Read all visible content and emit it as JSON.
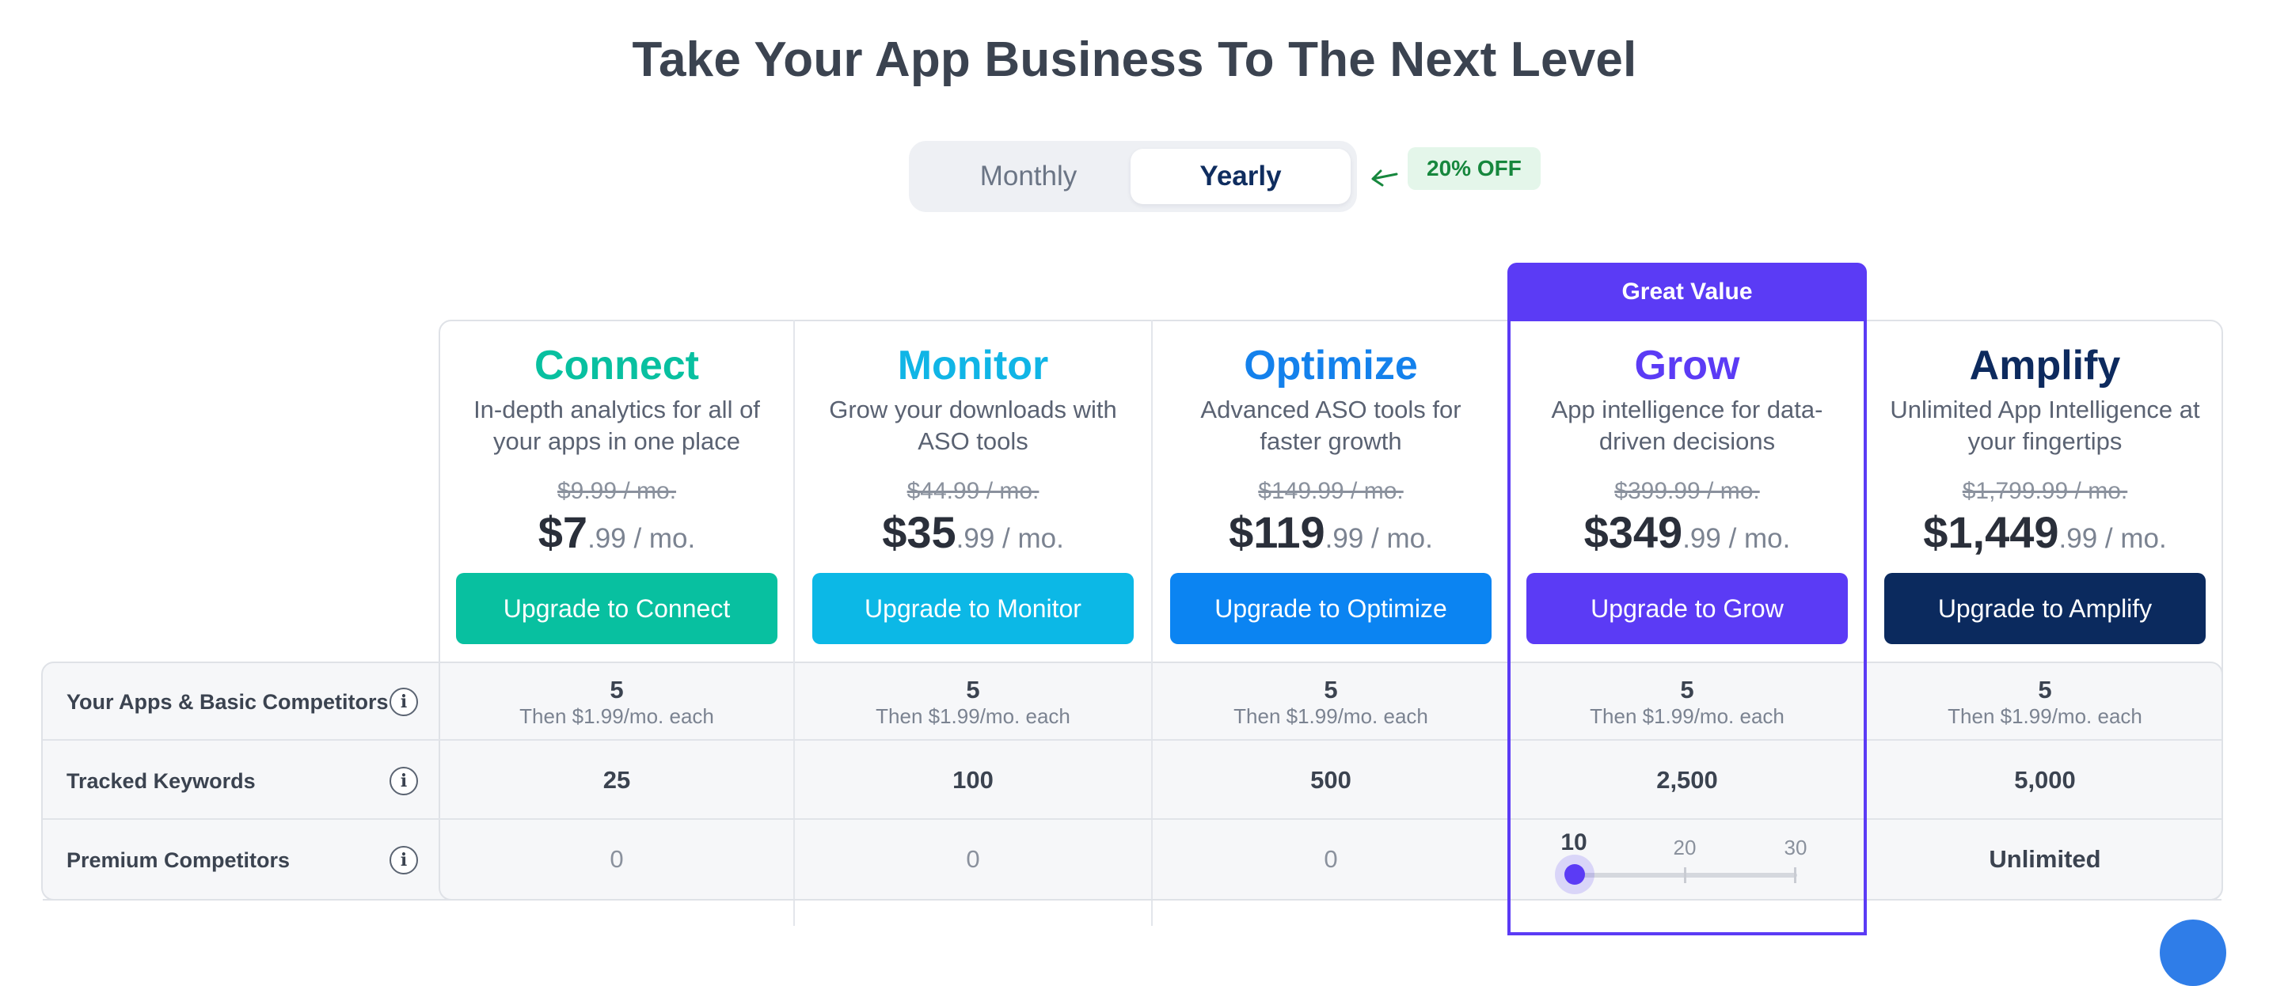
{
  "title": "Take Your App Business To The Next Level",
  "billing": {
    "monthly": "Monthly",
    "yearly": "Yearly",
    "selected": "Yearly",
    "discount": "20% OFF"
  },
  "highlight": {
    "label": "Great Value"
  },
  "plans": [
    {
      "name": "Connect",
      "color": "#08c0a0",
      "desc": "In-depth analytics for all of your apps in one place",
      "old_price": "$9.99 / mo.",
      "price_main": "$7",
      "price_cents": ".99 / mo.",
      "button": "Upgrade to Connect",
      "button_color": "#08c0a0"
    },
    {
      "name": "Monitor",
      "color": "#10b5e6",
      "desc": "Grow your downloads with ASO tools",
      "old_price": "$44.99 / mo.",
      "price_main": "$35",
      "price_cents": ".99 / mo.",
      "button": "Upgrade to Monitor",
      "button_color": "#0cb8e6"
    },
    {
      "name": "Optimize",
      "color": "#1481ec",
      "desc": "Advanced ASO tools for faster growth",
      "old_price": "$149.99 / mo.",
      "price_main": "$119",
      "price_cents": ".99 / mo.",
      "button": "Upgrade to Optimize",
      "button_color": "#0b84f2"
    },
    {
      "name": "Grow",
      "color": "#5b3bf5",
      "desc": "App intelligence for data-driven decisions",
      "old_price": "$399.99 / mo.",
      "price_main": "$349",
      "price_cents": ".99 / mo.",
      "button": "Upgrade to Grow",
      "button_color": "#5b3bf5"
    },
    {
      "name": "Amplify",
      "color": "#0d2a5e",
      "desc": "Unlimited App Intelligence at your fingertips",
      "old_price": "$1,799.99 / mo.",
      "price_main": "$1,449",
      "price_cents": ".99 / mo.",
      "button": "Upgrade to Amplify",
      "button_color": "#0b2a5e"
    }
  ],
  "features": [
    {
      "label": "Your Apps & Basic Competitors",
      "info": "i",
      "values": [
        "5",
        "5",
        "5",
        "5",
        "5"
      ],
      "sub": "Then $1.99/mo. each"
    },
    {
      "label": "Tracked Keywords",
      "info": "i",
      "values": [
        "25",
        "100",
        "500",
        "2,500",
        "5,000"
      ]
    },
    {
      "label": "Premium Competitors",
      "info": "i",
      "values": [
        "0",
        "0",
        "0",
        "",
        "Unlimited"
      ],
      "slider": {
        "options": [
          "10",
          "20",
          "30"
        ],
        "selected": "10"
      }
    }
  ]
}
